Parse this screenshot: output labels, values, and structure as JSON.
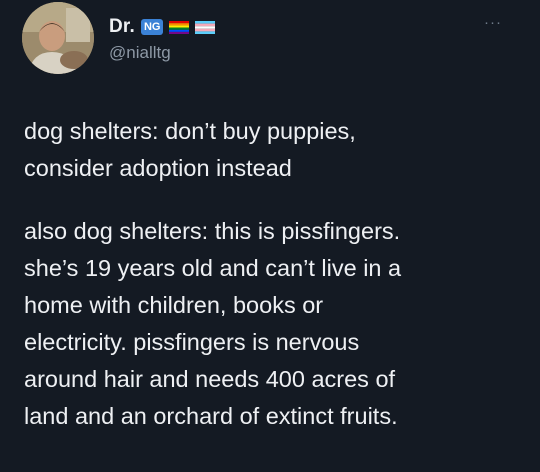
{
  "tweet": {
    "display_name": "Dr.",
    "badge": "NG",
    "handle": "@nialltg",
    "more_icon": "ellipsis-icon",
    "paragraph_1": "dog shelters: don’t buy puppies,\nconsider adoption instead",
    "paragraph_2": "also dog shelters: this is pissfingers.\nshe’s 19 years old and can’t live in a\nhome with children, books or\nelectricity. pissfingers is nervous\naround hair and needs 400 acres of\nland and an orchard of extinct fruits."
  },
  "colors": {
    "background": "#141a23",
    "text": "#eef0f3",
    "handle": "#8d98a5",
    "badge": "#3b82d6"
  }
}
